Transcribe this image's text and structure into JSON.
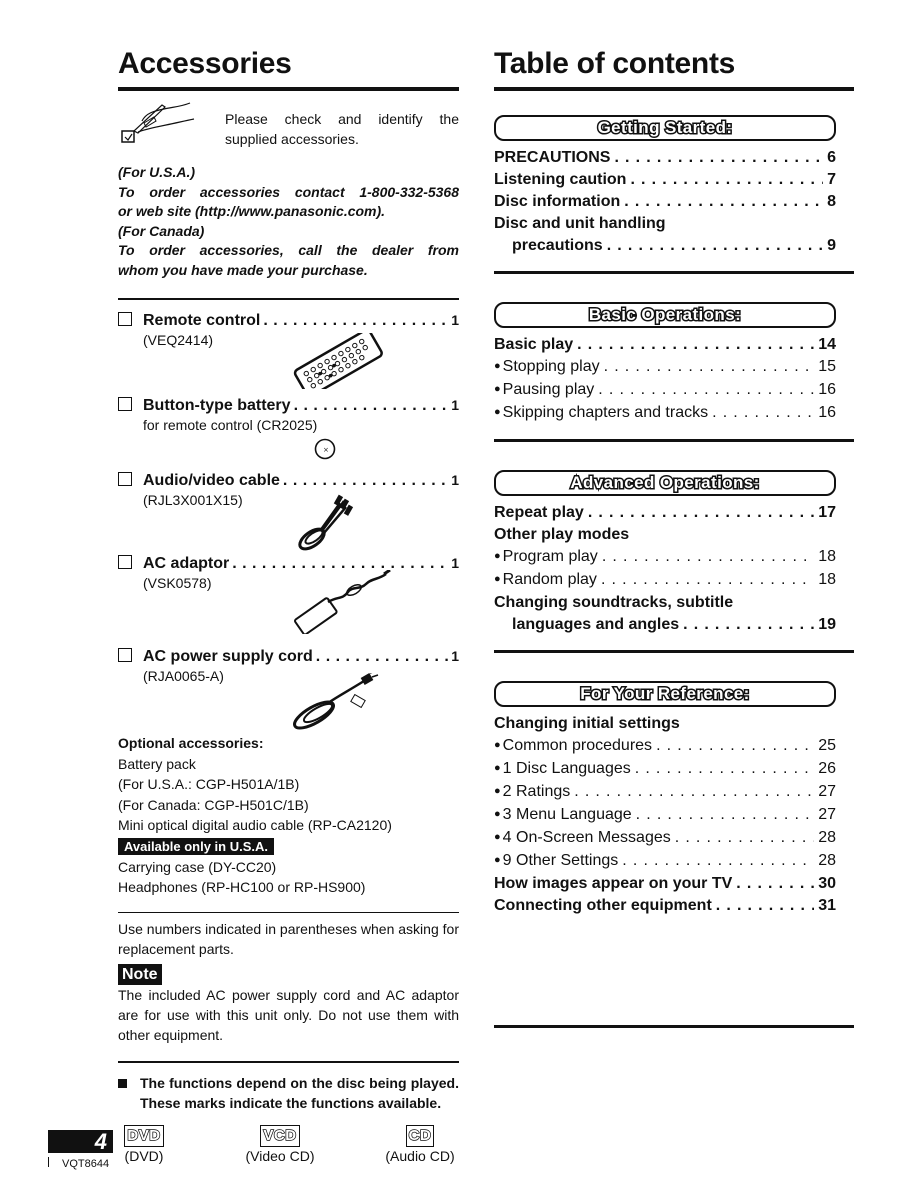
{
  "accessories": {
    "title": "Accessories",
    "intro": "Please check and identify the supplied accessories.",
    "order_info": {
      "usa_label": "(For U.S.A.)",
      "usa_text_1": "To order accessories contact 1-800-332-5368",
      "usa_text_2": "or web site (http://www.panasonic.com).",
      "canada_label": "(For Canada)",
      "canada_text_1": "To order accessories, call the dealer from",
      "canada_text_2": "whom you have made your purchase."
    },
    "items": [
      {
        "name": "Remote control",
        "qty": "1",
        "sub": "(VEQ2414)",
        "icon": "remote-control-icon"
      },
      {
        "name": "Button-type battery",
        "qty": "1",
        "sub": "for remote control (CR2025)",
        "icon": "coin-battery-icon"
      },
      {
        "name": "Audio/video cable",
        "qty": "1",
        "sub": "(RJL3X001X15)",
        "icon": "av-cable-icon"
      },
      {
        "name": "AC adaptor",
        "qty": "1",
        "sub": "(VSK0578)",
        "icon": "ac-adaptor-icon"
      },
      {
        "name": "AC power supply cord",
        "qty": "1",
        "sub": "(RJA0065-A)",
        "icon": "power-cord-icon"
      }
    ],
    "optional": {
      "heading": "Optional accessories:",
      "lines": [
        "Battery pack",
        "(For U.S.A.:  CGP-H501A/1B)",
        "(For Canada:  CGP-H501C/1B)",
        "Mini optical digital audio cable (RP-CA2120)"
      ],
      "usa_badge": "Available only in U.S.A.",
      "usa_lines": [
        "Carrying case (DY-CC20)",
        "Headphones (RP-HC100 or RP-HS900)"
      ]
    },
    "parts_note": "Use numbers indicated in parentheses when asking for replacement parts.",
    "note_label": "Note",
    "note_text": "The included AC power supply cord and AC adaptor are for use with this unit only. Do not use them with other equipment.",
    "functions_text": "The functions depend on the disc being played. These marks indicate the functions available.",
    "disc_marks": [
      {
        "mark": "DVD",
        "caption": "(DVD)"
      },
      {
        "mark": "VCD",
        "caption": "(Video CD)"
      },
      {
        "mark": "CD",
        "caption": "(Audio CD)"
      }
    ]
  },
  "toc": {
    "title": "Table of contents",
    "sections": [
      {
        "heading": "Getting Started:",
        "rows": [
          {
            "label": "PRECAUTIONS",
            "page": "6",
            "style": "bold"
          },
          {
            "label": "Listening caution",
            "page": "7",
            "style": "bold"
          },
          {
            "label": "Disc information",
            "page": "8",
            "style": "bold"
          },
          {
            "label": "Disc and unit handling",
            "page": "",
            "style": "bold"
          },
          {
            "label": "precautions",
            "page": "9",
            "style": "bold-indent"
          }
        ]
      },
      {
        "heading": "Basic Operations:",
        "rows": [
          {
            "label": "Basic play",
            "page": "14",
            "style": "bold"
          },
          {
            "label": "Stopping play",
            "page": "15",
            "style": "bullet"
          },
          {
            "label": "Pausing play",
            "page": "16",
            "style": "bullet"
          },
          {
            "label": "Skipping chapters and tracks",
            "page": "16",
            "style": "bullet"
          }
        ]
      },
      {
        "heading": "Advanced Operations:",
        "rows": [
          {
            "label": "Repeat play",
            "page": "17",
            "style": "bold"
          },
          {
            "label": "Other play modes",
            "page": "",
            "style": "bold"
          },
          {
            "label": "Program play",
            "page": "18",
            "style": "bullet"
          },
          {
            "label": "Random play",
            "page": "18",
            "style": "bullet"
          },
          {
            "label": "Changing soundtracks, subtitle",
            "page": "",
            "style": "bold"
          },
          {
            "label": "languages and angles",
            "page": "19",
            "style": "bold-indent"
          }
        ]
      },
      {
        "heading": "For Your Reference:",
        "rows": [
          {
            "label": "Changing initial settings",
            "page": "",
            "style": "bold"
          },
          {
            "label": "Common procedures",
            "page": "25",
            "style": "bullet"
          },
          {
            "label": "1 Disc Languages",
            "page": "26",
            "style": "bullet"
          },
          {
            "label": "2 Ratings",
            "page": "27",
            "style": "bullet"
          },
          {
            "label": "3 Menu Language",
            "page": "27",
            "style": "bullet"
          },
          {
            "label": "4 On-Screen Messages",
            "page": "28",
            "style": "bullet"
          },
          {
            "label": "9 Other Settings",
            "page": "28",
            "style": "bullet"
          },
          {
            "label": "How images appear on your TV",
            "page": "30",
            "style": "bold"
          },
          {
            "label": "Connecting other equipment",
            "page": "31",
            "style": "bold"
          }
        ]
      }
    ]
  },
  "footer": {
    "page_number": "4",
    "doc_code": "VQT8644"
  }
}
